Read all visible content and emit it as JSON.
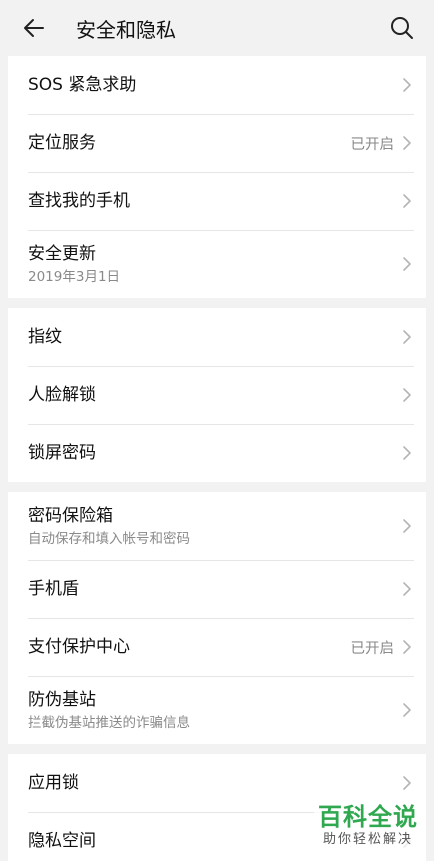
{
  "header": {
    "title": "安全和隐私"
  },
  "groups": [
    {
      "items": [
        {
          "label": "SOS 紧急求助"
        },
        {
          "label": "定位服务",
          "value": "已开启"
        },
        {
          "label": "查找我的手机"
        },
        {
          "label": "安全更新",
          "sub": "2019年3月1日"
        }
      ]
    },
    {
      "items": [
        {
          "label": "指纹"
        },
        {
          "label": "人脸解锁"
        },
        {
          "label": "锁屏密码"
        }
      ]
    },
    {
      "items": [
        {
          "label": "密码保险箱",
          "sub": "自动保存和填入帐号和密码"
        },
        {
          "label": "手机盾"
        },
        {
          "label": "支付保护中心",
          "value": "已开启"
        },
        {
          "label": "防伪基站",
          "sub": "拦截伪基站推送的诈骗信息"
        }
      ]
    },
    {
      "items": [
        {
          "label": "应用锁"
        },
        {
          "label": "隐私空间"
        }
      ]
    }
  ],
  "watermark": {
    "main": "百科全说",
    "sub": "助你轻松解决",
    "color": "#2fa84f"
  },
  "icons": {
    "back": "arrow-left-icon",
    "search": "search-icon",
    "chevron": "chevron-right-icon"
  }
}
